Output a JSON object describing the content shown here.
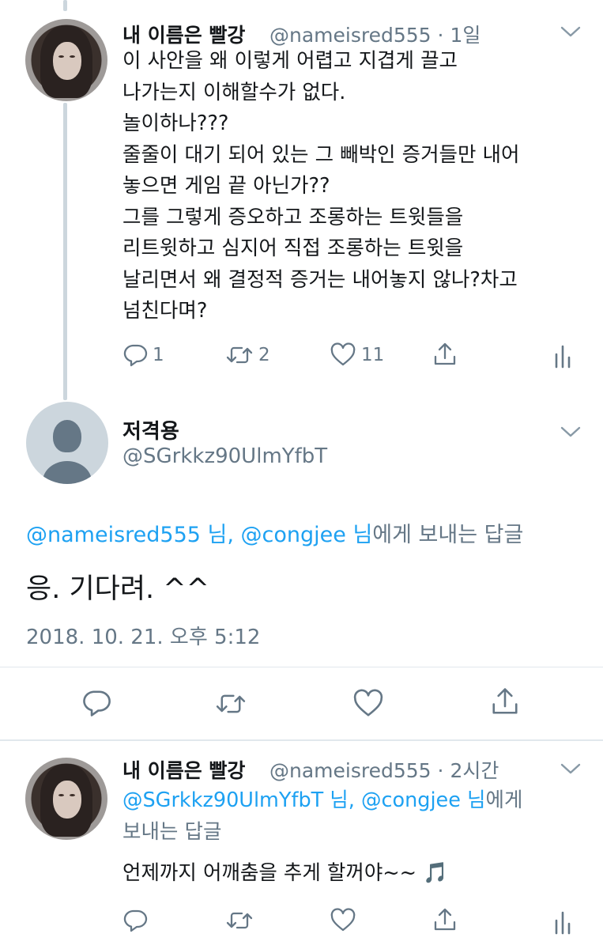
{
  "tweet1": {
    "name": "내 이름은 빨강",
    "handle": "@nameisred555",
    "separator": "·",
    "time": "1일",
    "lines": [
      "이 사안을 왜 이렇게 어렵고 지겹게 끌고",
      "나가는지 이해할수가 없다.",
      "놀이하나???",
      "줄줄이 대기 되어 있는 그 빼박인 증거들만 내어",
      "놓으면 게임 끝 아닌가??",
      "그를 그렇게 증오하고 조롱하는 트윗들을",
      "리트윗하고 심지어 직접 조롱하는 트윗을",
      "날리면서 왜 결정적 증거는 내어놓지 않나?차고",
      "넘친다며?"
    ],
    "reply_count": "1",
    "retweet_count": "2",
    "like_count": "11"
  },
  "focus_tweet": {
    "name": "저격용",
    "handle": "@SGrkkz90UlmYfbT",
    "reply_mention_1": "@nameisred555 님",
    "reply_mention_sep": ", ",
    "reply_mention_2": "@congjee 님",
    "reply_suffix": "에게 보내는 답글",
    "text": "응. 기다려. ^^",
    "timestamp": "2018. 10. 21. 오후 5:12"
  },
  "tweet3": {
    "name": "내 이름은 빨강",
    "handle": "@nameisred555",
    "separator": "·",
    "time": "2시간",
    "mention_1": "@SGrkkz90UlmYfbT 님",
    "mention_sep": ", ",
    "mention_2": "@congjee 님",
    "mention_suffix": "에게",
    "reply_line2": "보내는 답글",
    "text": "언제까지 어깨춤을 추게 할꺼야~~ 🎵"
  },
  "icons": {
    "reply": "reply-icon",
    "retweet": "retweet-icon",
    "like": "heart-icon",
    "share": "share-icon",
    "analytics": "analytics-icon",
    "menu": "chevron-down-icon"
  },
  "colors": {
    "link": "#1da1f2",
    "secondary": "#657786",
    "thread_line": "#ccd6dd"
  }
}
